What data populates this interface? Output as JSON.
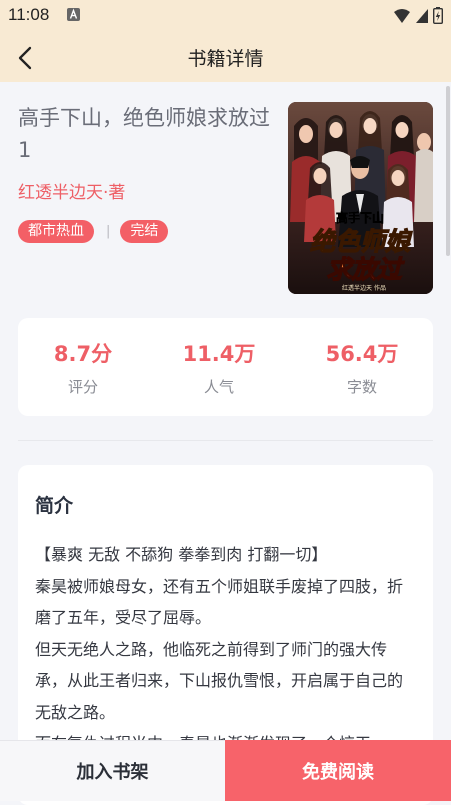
{
  "status_bar": {
    "time": "11:08"
  },
  "header": {
    "title": "书籍详情"
  },
  "book": {
    "title": "高手下山，绝色师娘求放过1",
    "author": "红透半边天·著",
    "tags": [
      "都市热血",
      "完结"
    ],
    "tag_divider": "|",
    "cover_text": {
      "top": "高手下山",
      "main_line1": "绝色师娘",
      "main_line2": "求放过",
      "credit": "红透半边天 作品"
    }
  },
  "stats": [
    {
      "value": "8.7分",
      "label": "评分"
    },
    {
      "value": "11.4万",
      "label": "人气"
    },
    {
      "value": "56.4万",
      "label": "字数"
    }
  ],
  "intro": {
    "heading": "简介",
    "lines": [
      "【暴爽 无敌 不舔狗 拳拳到肉 打翻一切】",
      "秦昊被师娘母女，还有五个师姐联手废掉了四肢，折磨了五年，受尽了屈辱。",
      "但天无绝人之路，他临死之前得到了师门的强大传承，从此王者归来，下山报仇雪恨，开启属于自己的无敌之路。",
      "而在复仇过程当中，秦昊也渐渐发现了一个惊天"
    ]
  },
  "bottom": {
    "add_shelf": "加入书架",
    "read_free": "免费阅读"
  },
  "colors": {
    "header_bg": "#f8ead3",
    "accent": "#f35f66",
    "page_bg": "#f4f5f9"
  }
}
